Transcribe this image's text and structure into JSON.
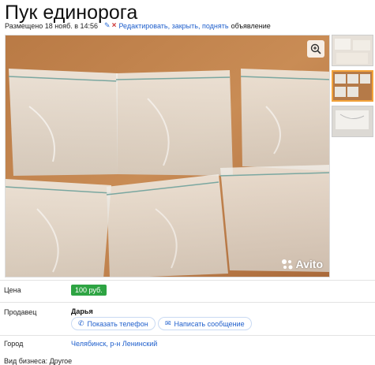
{
  "title": "Пук единорога",
  "meta": {
    "posted": "Размещено 18 нояб. в 14:56",
    "edit_links": "Редактировать, закрыть, поднять",
    "suffix": "объявление"
  },
  "photo": {
    "watermark": "Avito",
    "zoom_icon": "zoom-in-icon"
  },
  "thumbnails": [
    {
      "active": false
    },
    {
      "active": true
    },
    {
      "active": false
    }
  ],
  "details": {
    "price_label": "Цена",
    "price_value": "100 руб.",
    "seller_label": "Продавец",
    "seller_name": "Дарья",
    "show_phone": "Показать телефон",
    "write_message": "Написать сообщение",
    "city_label": "Город",
    "city_value": "Челябинск, р-н Ленинский",
    "business_type": "Вид бизнеса: Другое"
  },
  "colors": {
    "price_bg": "#2ea443",
    "link": "#1f5fcc",
    "thumb_active": "#f3a33a"
  }
}
